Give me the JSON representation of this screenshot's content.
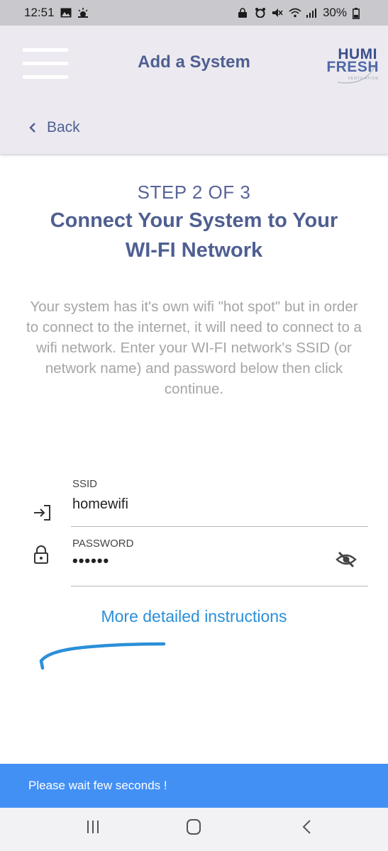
{
  "status_bar": {
    "time": "12:51",
    "battery": "30%"
  },
  "header": {
    "title": "Add a System",
    "logo": {
      "line1": "HUMI",
      "line2": "FRESH",
      "sub": "VENTILATION"
    },
    "back_label": "Back"
  },
  "step": {
    "label": "STEP 2 OF 3",
    "heading": "Connect Your System to Your WI-FI Network",
    "description": "Your system has it's own wifi \"hot spot\" but in order to connect to the internet, it will need to connect to a wifi network. Enter your WI-FI network's SSID (or network name) and password below then click continue."
  },
  "form": {
    "ssid": {
      "label": "SSID",
      "value": "homewifi"
    },
    "password": {
      "label": "PASSWORD",
      "value": "••••••"
    }
  },
  "links": {
    "instructions": "More detailed instructions"
  },
  "notice": {
    "text": "Please wait few seconds !"
  },
  "colors": {
    "header_bg": "#eceaf0",
    "accent": "#4f5f92",
    "link": "#2b8fd9",
    "notice_bg": "#4390f5"
  },
  "icons": {
    "status_left": [
      "gallery-icon",
      "weather-icon"
    ],
    "status_right": [
      "lock-icon",
      "alarm-icon",
      "mute-icon",
      "wifi-icon",
      "signal-icon",
      "battery-icon"
    ],
    "menu": "hamburger-icon",
    "back": "chevron-left-icon",
    "ssid": "login-arrow-icon",
    "password": "lock-icon",
    "password_toggle": "eye-off-icon"
  }
}
